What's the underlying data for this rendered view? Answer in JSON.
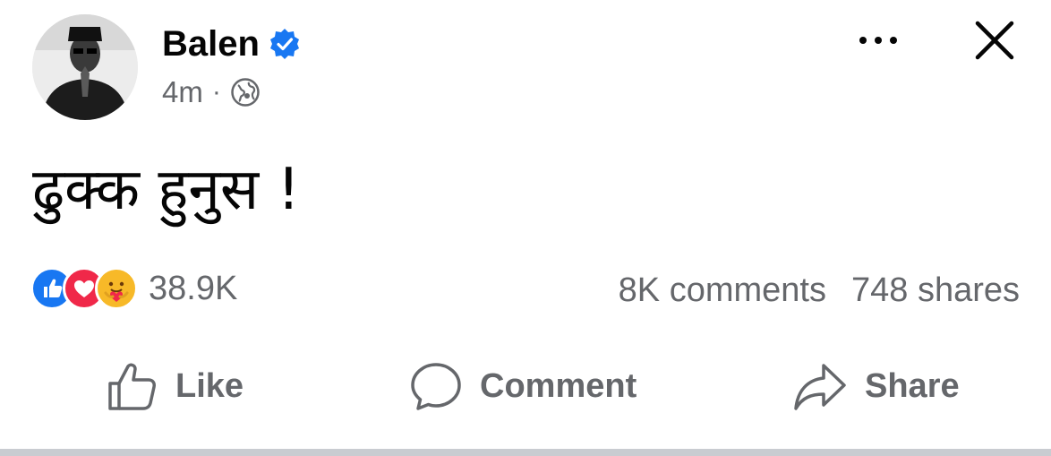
{
  "post": {
    "author": "Balen",
    "verified": true,
    "timestamp": "4m",
    "separator": "·",
    "privacy_icon": "globe-icon",
    "text": "ढुक्क हुनुस !"
  },
  "header_actions": {
    "more_icon": "more-dots-icon",
    "close_icon": "close-icon"
  },
  "engagement": {
    "reactions": [
      "like",
      "love",
      "care"
    ],
    "reaction_count": "38.9K",
    "comments": "8K comments",
    "shares": "748 shares"
  },
  "actions": {
    "like": "Like",
    "comment": "Comment",
    "share": "Share"
  },
  "colors": {
    "text_primary": "#050505",
    "text_secondary": "#65676b",
    "verified_blue": "#1877f2",
    "like_blue": "#1877f2",
    "love_red": "#f02849",
    "care_yellow": "#f7b928"
  }
}
